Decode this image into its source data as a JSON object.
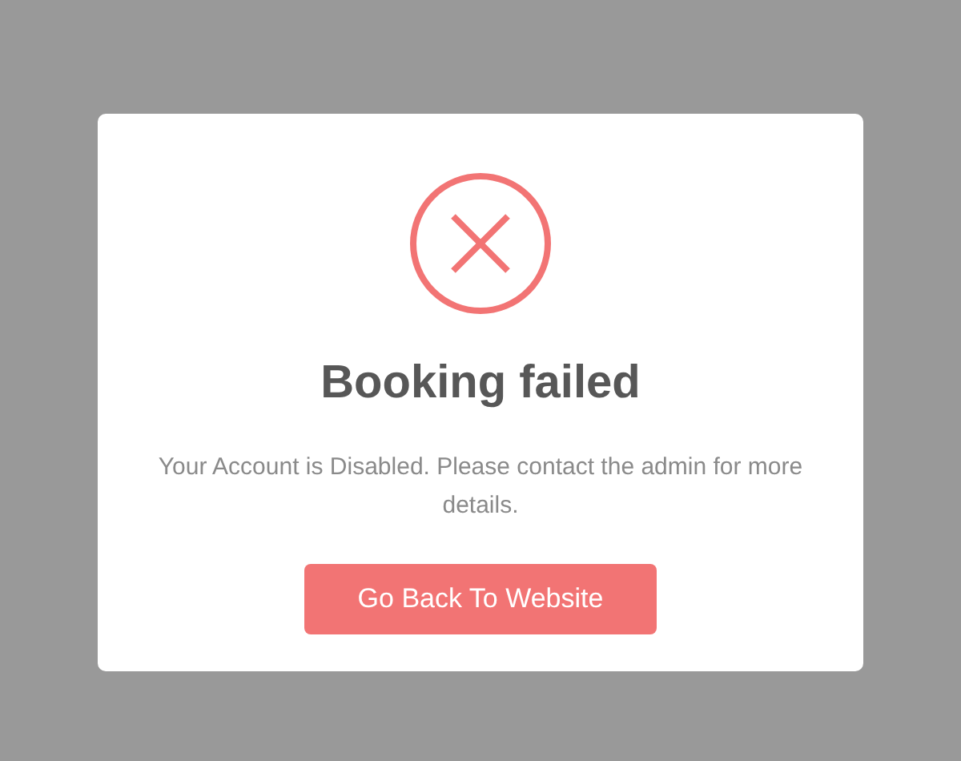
{
  "dialog": {
    "title": "Booking failed",
    "message": "Your Account is Disabled. Please contact the admin for more details.",
    "button": "Go Back To Website"
  }
}
